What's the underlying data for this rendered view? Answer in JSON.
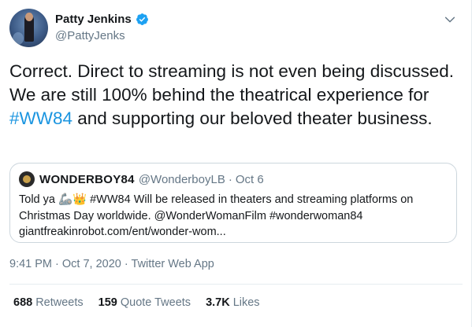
{
  "author": {
    "display_name": "Patty Jenkins",
    "handle": "@PattyJenks",
    "verified": true
  },
  "tweet": {
    "text_part1": "Correct. Direct to streaming is not even being discussed. We are still 100% behind the theatrical experience for ",
    "hashtag": "#WW84",
    "text_part2": " and supporting our beloved theater business."
  },
  "quoted_tweet": {
    "display_name": "WONDERBOY84",
    "handle": "@WonderboyLB",
    "separator": "·",
    "date": "Oct 6",
    "text": "Told ya 🦾👑 #WW84 Will be released in theaters and streaming platforms on Christmas Day worldwide. @WonderWomanFilm #wonderwoman84 giantfreakinrobot.com/ent/wonder-wom..."
  },
  "meta": {
    "time": "9:41 PM",
    "separator1": "·",
    "date": "Oct 7, 2020",
    "separator2": "·",
    "source": "Twitter Web App"
  },
  "stats": {
    "retweets_count": "688",
    "retweets_label": "Retweets",
    "quotes_count": "159",
    "quotes_label": "Quote Tweets",
    "likes_count": "3.7K",
    "likes_label": "Likes"
  },
  "colors": {
    "link": "#1b95e0",
    "secondary_text": "#657786",
    "border": "#ccd6dd",
    "verified": "#1da1f2"
  },
  "icons": {
    "verified": "verified-badge-icon",
    "more": "chevron-down-icon"
  }
}
